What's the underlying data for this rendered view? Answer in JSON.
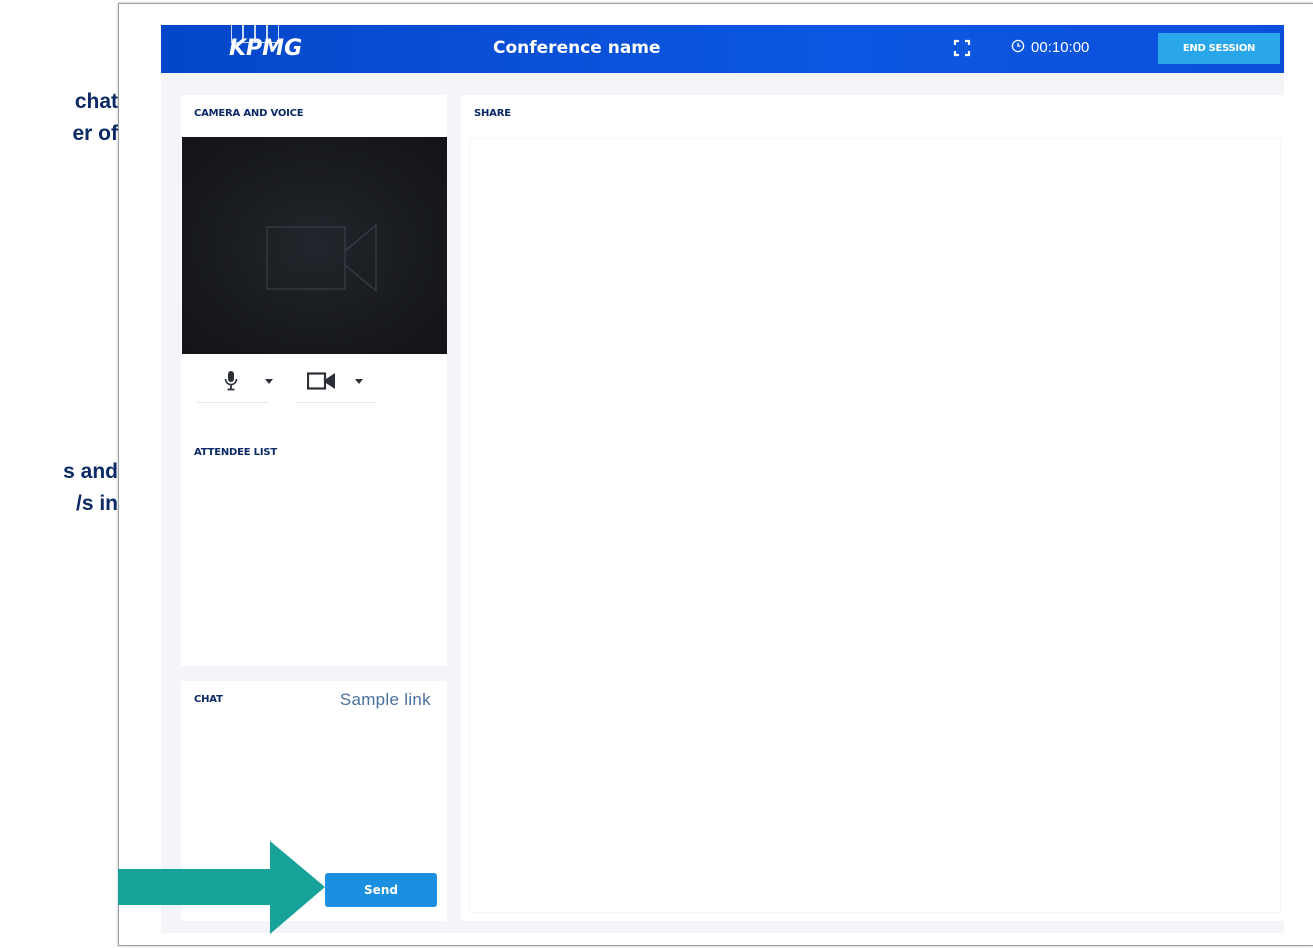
{
  "slide_text": {
    "top_lines": [
      "chat",
      "er of"
    ],
    "middle_lines": [
      "s and",
      "/s in"
    ]
  },
  "header": {
    "logo": "KPMG",
    "conference_name": "Conference name",
    "fullscreen_icon": "expand-icon",
    "timer_icon": "clock-icon",
    "timer": "00:10:00",
    "end_session_label": "END SESSION"
  },
  "camera": {
    "title": "CAMERA AND VOICE",
    "video_placeholder_icon": "video-camera-icon",
    "controls": [
      {
        "icon": "microphone-icon"
      },
      {
        "icon": "chevron-down-icon"
      },
      {
        "icon": "video-camera-icon"
      },
      {
        "icon": "chevron-down-icon"
      }
    ]
  },
  "attendees": {
    "title": "ATTENDEE LIST"
  },
  "chat": {
    "title": "CHAT",
    "sample_link": "Sample link",
    "send_label": "Send"
  },
  "share": {
    "title": "SHARE"
  },
  "colors": {
    "header_blue": "#0a4bd6",
    "end_session_button": "#2aa6ea",
    "send_button": "#1b8fe0",
    "title_navy": "#0b2a66",
    "arrow_teal": "#17a29a",
    "video_bg": "#16181d"
  },
  "annotation_arrow": "arrow-right-icon"
}
